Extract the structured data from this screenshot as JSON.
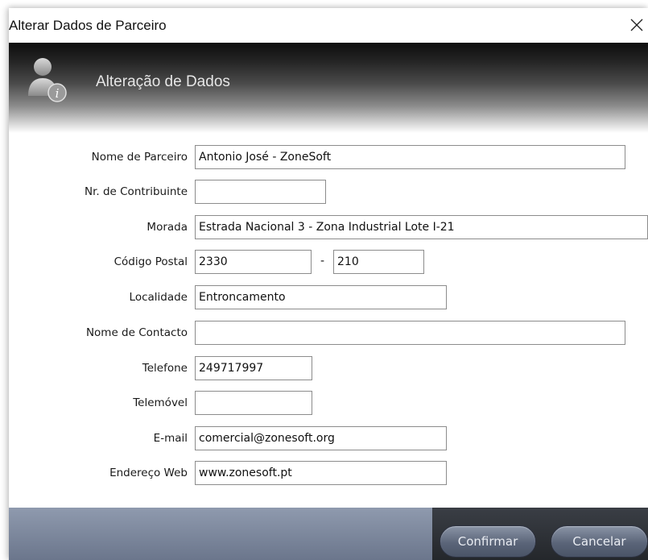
{
  "window": {
    "title": "Alterar Dados de Parceiro",
    "close_glyph": "✕"
  },
  "header": {
    "title": "Alteração de Dados",
    "icon": "user-info-icon"
  },
  "form": {
    "nome_parceiro": {
      "label": "Nome de Parceiro",
      "value": "Antonio José - ZoneSoft"
    },
    "nif": {
      "label": "Nr. de Contribuinte",
      "value": ""
    },
    "morada": {
      "label": "Morada",
      "value": "Estrada Nacional 3 - Zona Industrial Lote I-21"
    },
    "codigo_postal": {
      "label": "Código Postal",
      "value1": "2330",
      "separator": "-",
      "value2": "210"
    },
    "localidade": {
      "label": "Localidade",
      "value": "Entroncamento"
    },
    "nome_contacto": {
      "label": "Nome de Contacto",
      "value": ""
    },
    "telefone": {
      "label": "Telefone",
      "value": "249717997"
    },
    "telemovel": {
      "label": "Telemóvel",
      "value": ""
    },
    "email": {
      "label": "E-mail",
      "value": "comercial@zonesoft.org"
    },
    "web": {
      "label": "Endereço Web",
      "value": "www.zonesoft.pt"
    }
  },
  "footer": {
    "confirm_label": "Confirmar",
    "cancel_label": "Cancelar"
  },
  "colors": {
    "footer_left": "#7a859b",
    "footer_right": "#2e3238",
    "button": "#5b6579"
  }
}
